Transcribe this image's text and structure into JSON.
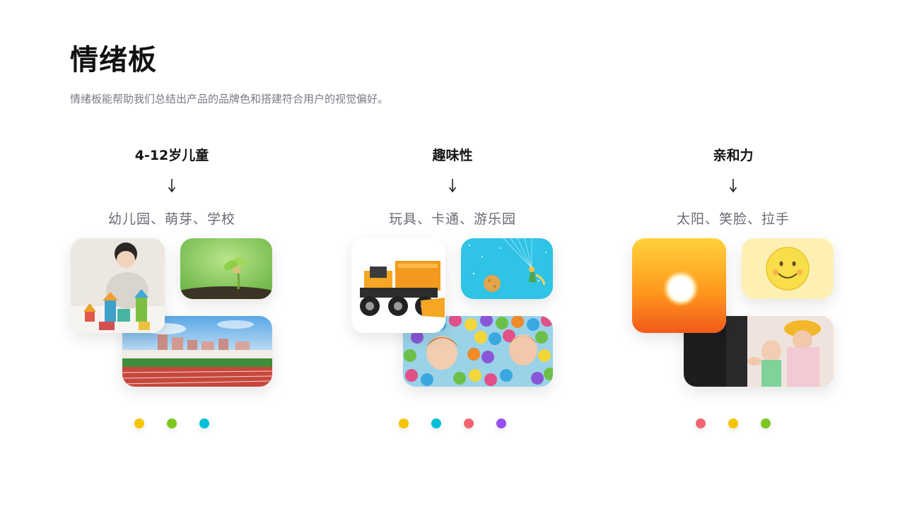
{
  "header": {
    "title": "情绪板",
    "subtitle": "情绪板能帮助我们总结出产品的品牌色和搭建符合用户的视觉偏好。"
  },
  "columns": [
    {
      "heading": "4-12岁儿童",
      "keywords": "幼儿园、萌芽、学校",
      "photos": [
        "toddler-building-blocks-photo",
        "seedling-sprout-photo",
        "school-running-track-photo"
      ],
      "palette": [
        "#f6c500",
        "#7cc71d",
        "#00bfd8"
      ]
    },
    {
      "heading": "趣味性",
      "keywords": "玩具、卡通、游乐园",
      "photos": [
        "toy-bulldozer-photo",
        "cartoon-little-prince-illustration",
        "kids-ball-pit-photo"
      ],
      "palette": [
        "#f6c500",
        "#00bfd8",
        "#f26470",
        "#9650f0"
      ]
    },
    {
      "heading": "亲和力",
      "keywords": "太阳、笑脸、拉手",
      "photos": [
        "sunset-sun-photo",
        "smiley-face-illustration",
        "holding-hands-child-photo"
      ],
      "palette": [
        "#f26470",
        "#f6c500",
        "#7cc71d"
      ]
    }
  ]
}
